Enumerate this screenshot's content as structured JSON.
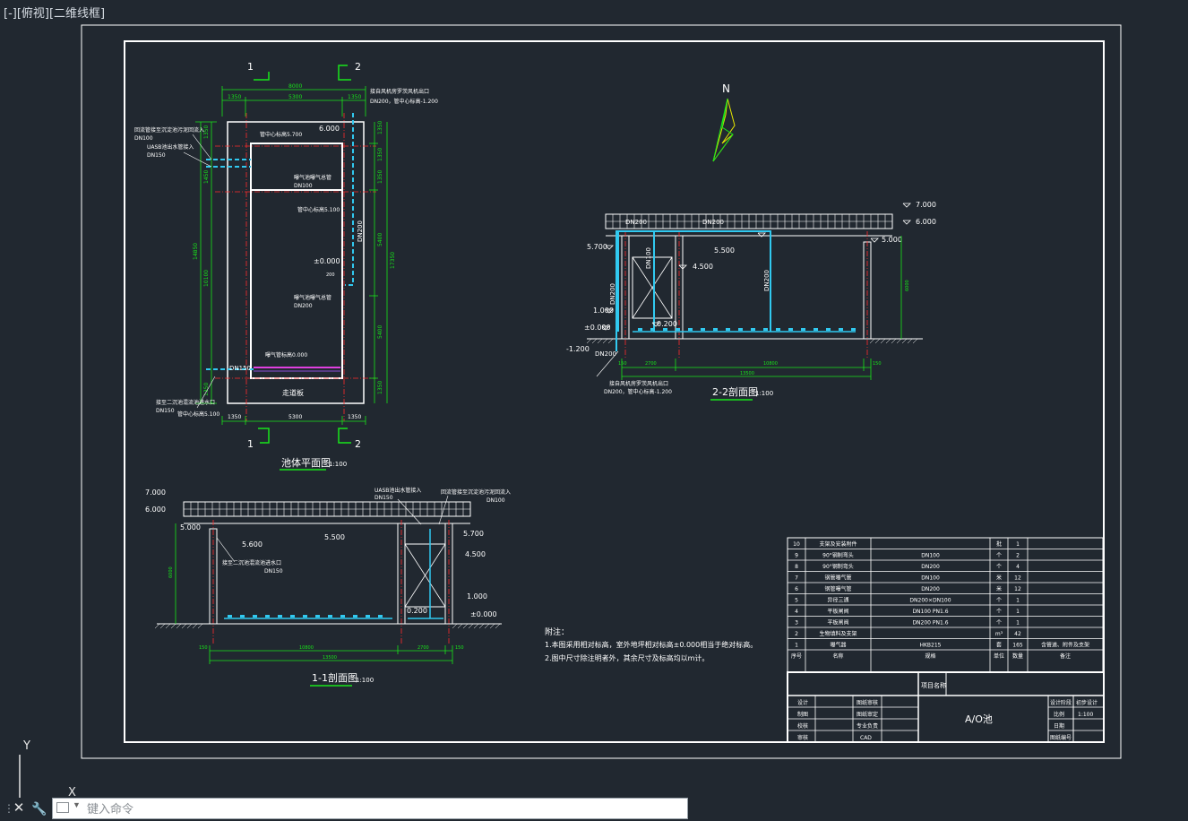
{
  "viewport": {
    "label": "[-][俯视][二维线框]"
  },
  "colors": {
    "bg": "#212830",
    "white": "#ffffff",
    "green": "#18e51a",
    "red": "#ff2b2b",
    "cyan": "#31c9f0",
    "blue": "#2a6cf0",
    "magenta": "#e040e0",
    "yellow": "#e8e800"
  },
  "plan": {
    "title": "池体平面图",
    "scale": "1:100",
    "sec1": "1",
    "sec2": "2",
    "dim_top_total": "8000",
    "dim_left_seg": "1350",
    "dim_mid_seg": "5300",
    "dim_right_seg": "1350",
    "dim_right": [
      "1350",
      "1350",
      "1350",
      "5400",
      "1350"
    ],
    "dim_right_outer": "17350",
    "dim_bottom_seg": "5300",
    "dim_left_a": "1350",
    "dim_left_b": "1450",
    "dim_left_c": "14850",
    "dim_left_d": "10100",
    "dim_left_e": "1350",
    "elev_6000": "6.000",
    "label_dn200_v": "DN200",
    "label_dn150": "DN150",
    "label_corridor": "走道板",
    "label_pm0": "±0.000",
    "label_200": "200",
    "label_5400": "5400",
    "labels": [
      {
        "text": "接自风机房罗茨风机出口"
      },
      {
        "text": "DN200，管中心标高-1.200"
      },
      {
        "text": "回流管接至沉淀池污泥回流入"
      },
      {
        "text": "DN100"
      },
      {
        "text": "UASB池出水管接入"
      },
      {
        "text": "DN150"
      },
      {
        "text": "管中心标高5.700"
      },
      {
        "text": "曝气池曝气总管"
      },
      {
        "text": "DN100"
      },
      {
        "text": "管中心标高5.100"
      },
      {
        "text": "曝气池曝气总管"
      },
      {
        "text": "DN200"
      },
      {
        "text": "曝气管标高0.000"
      },
      {
        "text": "接至二沉池混流池进水口"
      },
      {
        "text": "DN150"
      },
      {
        "text": "管中心标高5.100"
      }
    ]
  },
  "sec22": {
    "title": "2-2剖面图",
    "scale": "1:100",
    "elev": [
      "7.000",
      "6.000",
      "5.000",
      "5.700",
      "5.500",
      "4.500",
      "1.000",
      "±0.000",
      "0.200",
      "-1.200"
    ],
    "pipes": [
      "DN200",
      "DN200",
      "DN100",
      "DN200",
      "DN200",
      "DN200"
    ],
    "dims": [
      "150",
      "2700",
      "10800",
      "150",
      "13500",
      "6000"
    ],
    "note1": "接自风机房罗茨风机出口",
    "note2": "DN200，管中心标高-1.200"
  },
  "sec11": {
    "title": "1-1剖面图",
    "scale": "1:100",
    "elev": [
      "7.000",
      "6.000",
      "5.000",
      "5.600",
      "5.500",
      "5.700",
      "4.500",
      "1.000",
      "±0.000",
      "0.200"
    ],
    "dims": [
      "150",
      "10800",
      "2700",
      "150",
      "13500",
      "6000"
    ],
    "note_a": "UASB池出水管接入",
    "note_a2": "DN150",
    "note_b": "回流管接至沉淀池污泥回流入",
    "note_b2": "DN100",
    "note_c": "接至二沉池混流池进水口",
    "note_c2": "DN150"
  },
  "north": {
    "label": "N"
  },
  "notes": {
    "title": "附注：",
    "lines": [
      "1.本图采用相对标高，室外地坪相对标高±0.000相当于绝对标高。",
      "2.图中尺寸除注明者外，其余尺寸及标高均以m计。"
    ]
  },
  "parts": {
    "rows": [
      [
        "10",
        "支架及安装附件",
        "",
        "批",
        "1",
        ""
      ],
      [
        "9",
        "90°钢制弯头",
        "DN100",
        "个",
        "2",
        ""
      ],
      [
        "8",
        "90°钢制弯头",
        "DN200",
        "个",
        "4",
        ""
      ],
      [
        "7",
        "钢管曝气管",
        "DN100",
        "米",
        "12",
        ""
      ],
      [
        "6",
        "钢管曝气管",
        "DN200",
        "米",
        "12",
        ""
      ],
      [
        "5",
        "异径三通",
        "DN200×DN100",
        "个",
        "1",
        ""
      ],
      [
        "4",
        "平板闸阀",
        "DN100 PN1.6",
        "个",
        "1",
        ""
      ],
      [
        "3",
        "平板闸阀",
        "DN200 PN1.6",
        "个",
        "1",
        ""
      ],
      [
        "2",
        "生物填料及支架",
        "",
        "m³",
        "42",
        ""
      ],
      [
        "1",
        "曝气器",
        "HKB215",
        "套",
        "165",
        "含管道、附件及支架"
      ]
    ],
    "header": [
      "序号",
      "名称",
      "规格",
      "单位",
      "数量",
      "备注"
    ]
  },
  "titleblock": {
    "project_label": "项目名称",
    "drawing_name": "A/O池",
    "left_rows": [
      [
        "设计",
        "图纸审核"
      ],
      [
        "制图",
        "图纸审定"
      ],
      [
        "校核",
        "专业负责"
      ],
      [
        "审核",
        "CAD"
      ]
    ],
    "right_rows": [
      [
        "设计阶段",
        "初步设计"
      ],
      [
        "比例",
        "1:100"
      ],
      [
        "日期",
        ""
      ],
      [
        "图纸编号",
        ""
      ]
    ]
  },
  "ucs": {
    "y": "Y",
    "x": "X"
  },
  "command": {
    "placeholder": "键入命令",
    "close": "✕",
    "wrench": "🔧"
  }
}
